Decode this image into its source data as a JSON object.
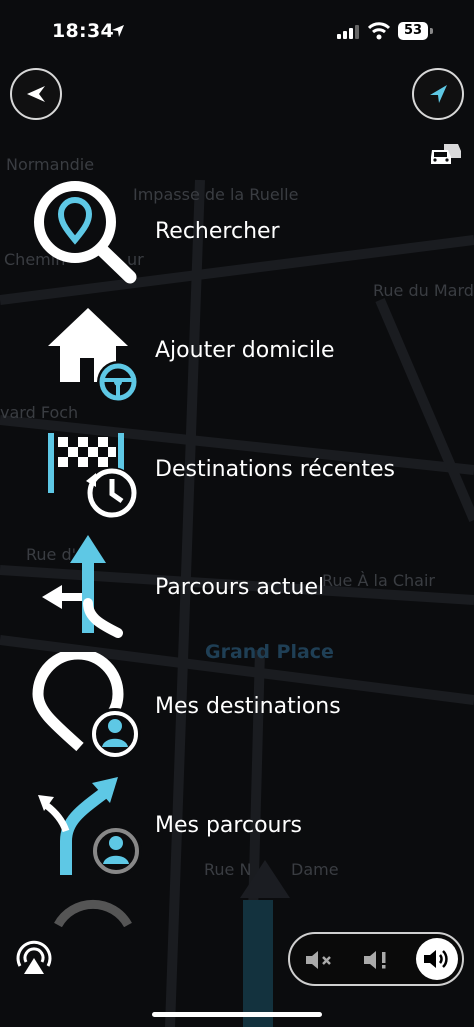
{
  "status_bar": {
    "time": "18:34",
    "battery": "53"
  },
  "map": {
    "streets": [
      "Normandie",
      "Impasse de la Ruelle",
      "Chemin",
      "ur",
      "Rue du Mard",
      "vard Foch",
      "Rue d'",
      "Rue À la Chair",
      "Rue N",
      "Dame"
    ],
    "place": "Grand Place"
  },
  "menu": {
    "items": [
      {
        "label": "Rechercher",
        "icon": "search-pin-icon"
      },
      {
        "label": "Ajouter domicile",
        "icon": "home-steering-icon"
      },
      {
        "label": "Destinations récentes",
        "icon": "checkered-flag-clock-icon"
      },
      {
        "label": "Parcours actuel",
        "icon": "route-arrows-icon"
      },
      {
        "label": "Mes destinations",
        "icon": "pin-profile-icon"
      },
      {
        "label": "Mes parcours",
        "icon": "routes-profile-icon"
      }
    ]
  },
  "colors": {
    "accent": "#5ec8e5",
    "background": "#0b0c0e"
  }
}
